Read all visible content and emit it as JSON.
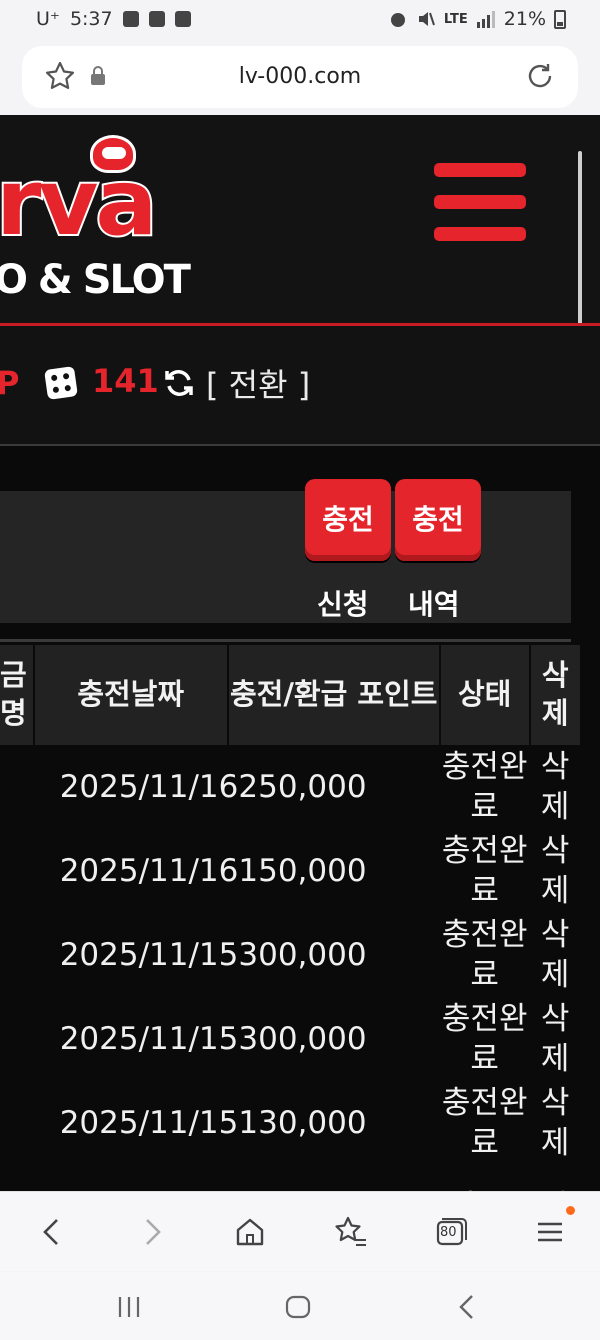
{
  "status_bar": {
    "carrier": "U⁺",
    "time": "5:37",
    "network": "LTE",
    "battery": "21%"
  },
  "browser": {
    "url": "lv-000.com"
  },
  "site": {
    "logo_text": "rva",
    "logo_sub": "O & SLOT",
    "info": {
      "point_letter": "P",
      "count": "141",
      "switch_label": "[ 전환 ]"
    }
  },
  "panel": {
    "apply_button": "충전",
    "history_button": "충전",
    "apply_caption": "신청",
    "history_caption": "내역"
  },
  "table": {
    "headers": {
      "col0_line1": "금",
      "col0_line2": "명",
      "date": "충전날짜",
      "amount": "충전/환급 포인트",
      "status": "상태",
      "delete": "삭제"
    },
    "rows": [
      {
        "date": "2025/11/16",
        "amount": "250,000",
        "status": "충전완료",
        "delete": "삭제"
      },
      {
        "date": "2025/11/16",
        "amount": "150,000",
        "status": "충전완료",
        "delete": "삭제"
      },
      {
        "date": "2025/11/15",
        "amount": "300,000",
        "status": "충전완료",
        "delete": "삭제"
      },
      {
        "date": "2025/11/15",
        "amount": "300,000",
        "status": "충전완료",
        "delete": "삭제"
      },
      {
        "date": "2025/11/15",
        "amount": "130,000",
        "status": "충전완료",
        "delete": "삭제"
      },
      {
        "date": "",
        "amount": "",
        "status": "충전",
        "delete": "삭"
      }
    ]
  },
  "bottom_nav": {
    "tabs_count": "80"
  },
  "colors": {
    "brand_red": "#e5252b",
    "page_bg": "#0a0a0a",
    "header_bg": "#131313"
  }
}
